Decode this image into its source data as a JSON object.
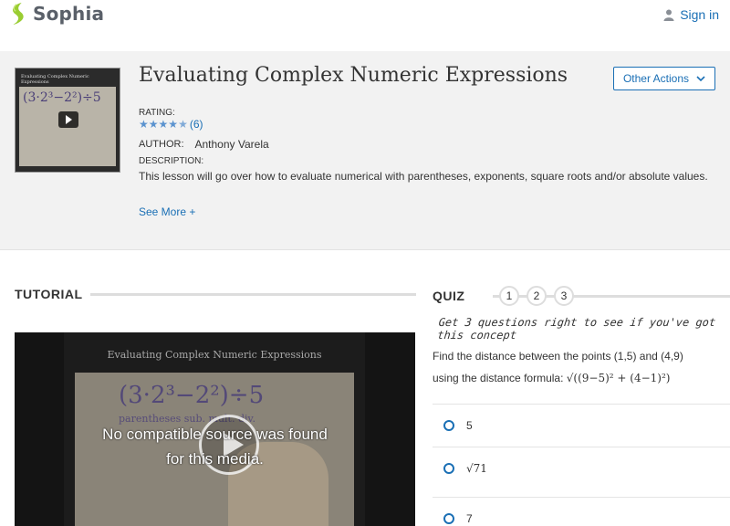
{
  "header": {
    "logo_text": "Sophia",
    "signin_label": "Sign in"
  },
  "lesson": {
    "title": "Evaluating Complex Numeric Expressions",
    "thumbnail_title": "Evaluating Complex Numeric Expressions",
    "thumbnail_math": "(3·2³−2²)÷5",
    "other_actions_label": "Other Actions",
    "rating_label": "RATING:",
    "rating_stars": 4.5,
    "rating_count": "(6)",
    "author_label": "AUTHOR:",
    "author_name": "Anthony Varela",
    "description_label": "DESCRIPTION:",
    "description": "This lesson will go over how to evaluate numerical with parentheses, exponents, square roots and/or absolute values.",
    "see_more_label": "See More +"
  },
  "tutorial": {
    "heading": "TUTORIAL",
    "video_title": "Evaluating Complex Numeric Expressions",
    "video_math": "(3·2³−2²)÷5",
    "video_note": "parentheses   sub.  mult.  div.",
    "error_line1": "No compatible source was found",
    "error_line2": "for this media."
  },
  "quiz": {
    "heading": "QUIZ",
    "question_numbers": [
      "1",
      "2",
      "3"
    ],
    "prompt": "Get 3 questions right to see if you've got this concept",
    "question_line1": "Find the distance between the points (1,5) and (4,9)",
    "question_line2": "using the distance formula:",
    "formula": "√((9−5)² + (4−1)²)",
    "answers": [
      "5",
      "√71",
      "7"
    ]
  },
  "colors": {
    "accent": "#1a6fb5",
    "logo_green": "#9acd32",
    "band_bg": "#f2f2f2"
  }
}
